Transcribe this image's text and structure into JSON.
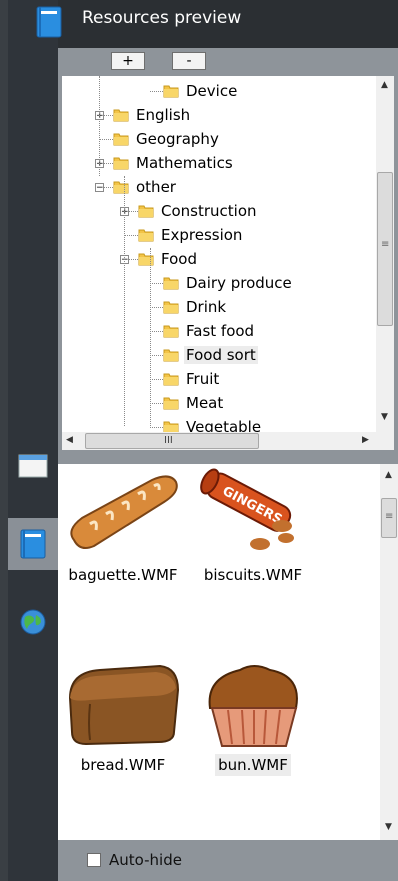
{
  "header": {
    "title": "Resources preview"
  },
  "toolbar": {
    "expand_label": "+",
    "collapse_label": "-"
  },
  "tree": {
    "items": [
      {
        "label": "Device",
        "level": 2,
        "toggle": "none"
      },
      {
        "label": "English",
        "level": 0,
        "toggle": "+"
      },
      {
        "label": "Geography",
        "level": 0,
        "toggle": "none"
      },
      {
        "label": "Mathematics",
        "level": 0,
        "toggle": "+"
      },
      {
        "label": "other",
        "level": 0,
        "toggle": "-"
      },
      {
        "label": "Construction",
        "level": 1,
        "toggle": "+"
      },
      {
        "label": "Expression",
        "level": 1,
        "toggle": "none"
      },
      {
        "label": "Food",
        "level": 1,
        "toggle": "-"
      },
      {
        "label": "Dairy produce",
        "level": 2,
        "toggle": "none"
      },
      {
        "label": "Drink",
        "level": 2,
        "toggle": "none"
      },
      {
        "label": "Fast food",
        "level": 2,
        "toggle": "none"
      },
      {
        "label": "Food sort",
        "level": 2,
        "toggle": "none",
        "selected": true
      },
      {
        "label": "Fruit",
        "level": 2,
        "toggle": "none"
      },
      {
        "label": "Meat",
        "level": 2,
        "toggle": "none"
      },
      {
        "label": "Vegetable",
        "level": 2,
        "toggle": "none"
      }
    ],
    "hscroll_grip": "III",
    "vscroll_grip": "≡"
  },
  "files": {
    "items": [
      {
        "name": "baguette.WMF",
        "icon": "baguette-image"
      },
      {
        "name": "biscuits.WMF",
        "icon": "biscuits-image"
      },
      {
        "name": "bread.WMF",
        "icon": "bread-image"
      },
      {
        "name": "bun.WMF",
        "icon": "bun-image",
        "selected": true
      }
    ],
    "scroll_grip": "≡"
  },
  "footer": {
    "autohide_label": "Auto-hide",
    "autohide_checked": false
  },
  "sidebar": {
    "icons": [
      "window-icon",
      "book-icon",
      "globe-icon"
    ],
    "active": "book-icon"
  },
  "colors": {
    "panel": "#8e949a",
    "sidebar": "#2f343a",
    "header": "#2b2f33",
    "active_tab": "#8a9097"
  }
}
